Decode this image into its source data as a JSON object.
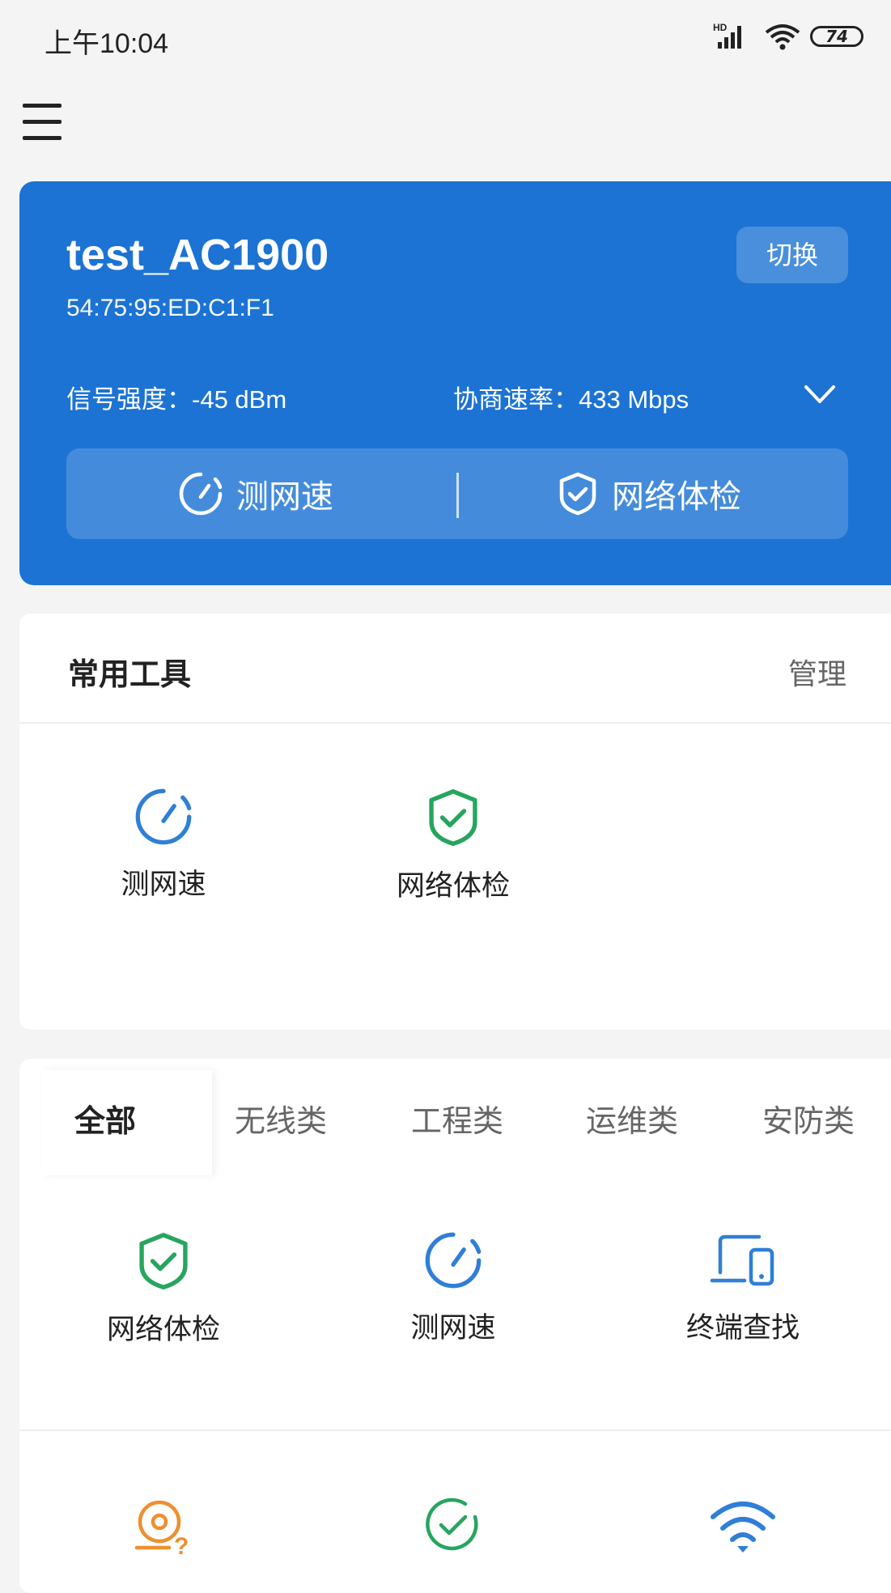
{
  "status_bar": {
    "time": "上午10:04",
    "network": "HD",
    "battery": "74"
  },
  "network_card": {
    "ssid": "test_AC1900",
    "mac": "54:75:95:ED:C1:F1",
    "switch_label": "切换",
    "signal_strength": "信号强度：-45 dBm",
    "negotiated_rate": "协商速率：433 Mbps",
    "actions": [
      {
        "label": "测网速",
        "icon": "speedometer-icon"
      },
      {
        "label": "网络体检",
        "icon": "shield-check-icon"
      }
    ],
    "colors": {
      "background": "#1c73d3",
      "text": "#ffffff"
    }
  },
  "tools_section": {
    "title": "常用工具",
    "manage_label": "管理",
    "items": [
      {
        "label": "测网速",
        "icon": "speedometer-icon",
        "color": "#2f7fd6"
      },
      {
        "label": "网络体检",
        "icon": "shield-check-icon",
        "color": "#27a55e"
      }
    ]
  },
  "categories": {
    "tabs": [
      "全部",
      "无线类",
      "工程类",
      "运维类",
      "安防类"
    ],
    "active_tab": "全部",
    "items": [
      {
        "label": "网络体检",
        "icon": "shield-check-icon",
        "color": "#27a55e"
      },
      {
        "label": "测网速",
        "icon": "speedometer-icon",
        "color": "#2f7fd6"
      },
      {
        "label": "终端查找",
        "icon": "device-search-icon",
        "color": "#2f7fd6"
      }
    ],
    "next_row_icons": [
      {
        "icon": "disk-question-icon",
        "color": "#ef8f2f"
      },
      {
        "icon": "check-circle-icon",
        "color": "#27a55e"
      },
      {
        "icon": "wifi-icon",
        "color": "#2f7fd6"
      }
    ]
  }
}
